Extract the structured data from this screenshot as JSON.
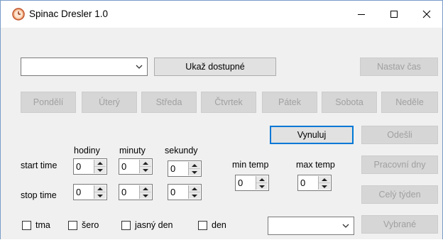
{
  "window": {
    "title": "Spinac Dresler 1.0",
    "minimize_glyph": "—",
    "maximize_glyph": "☐",
    "close_glyph": "✕"
  },
  "top": {
    "port_value": "",
    "show_available_label": "Ukaž dostupné",
    "set_time_label": "Nastav čas"
  },
  "days": [
    {
      "label": "Pondělí"
    },
    {
      "label": "Úterý"
    },
    {
      "label": "Středa"
    },
    {
      "label": "Čtvrtek"
    },
    {
      "label": "Pátek"
    },
    {
      "label": "Sobota"
    },
    {
      "label": "Neděle"
    }
  ],
  "time": {
    "hours_label": "hodiny",
    "minutes_label": "minuty",
    "seconds_label": "sekundy",
    "start_label": "start time",
    "stop_label": "stop time",
    "start": {
      "hours": "0",
      "minutes": "0",
      "seconds": "0"
    },
    "stop": {
      "hours": "0",
      "minutes": "0",
      "seconds": "0"
    }
  },
  "temp": {
    "min_label": "min temp",
    "max_label": "max temp",
    "min_value": "0",
    "max_value": "0"
  },
  "actions": {
    "reset_label": "Vynuluj",
    "send_label": "Odešli",
    "workdays_label": "Pracovní dny",
    "whole_week_label": "Celý týden",
    "selected_label": "Vybrané"
  },
  "light": {
    "options": [
      {
        "label": "tma",
        "checked": false
      },
      {
        "label": "šero",
        "checked": false
      },
      {
        "label": "jasný den",
        "checked": false
      },
      {
        "label": "den",
        "checked": false
      }
    ],
    "combo_value": ""
  },
  "colors": {
    "accent": "#0078d7",
    "disabled_text": "#a0a0a0",
    "client_bg": "#f0f0f0"
  }
}
